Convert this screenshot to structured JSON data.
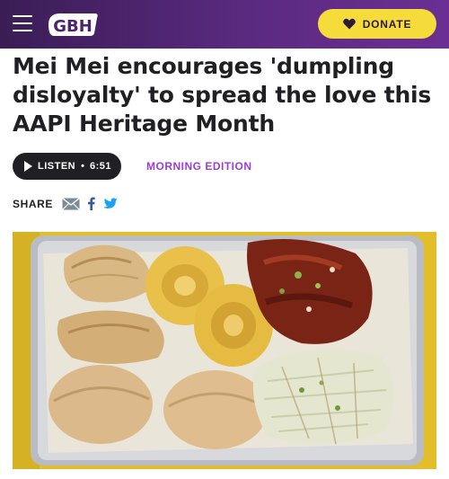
{
  "header": {
    "logo_text": "GBH",
    "donate_label": "DONATE",
    "icons": {
      "menu": "hamburger-menu-icon",
      "donate": "heart-icon"
    },
    "colors": {
      "bar": "#4a2470",
      "donate": "#f5dc3a"
    }
  },
  "article": {
    "headline": "Mei Mei encourages 'dumpling disloyalty' to spread the love this AAPI Heritage Month",
    "listen": {
      "label": "LISTEN",
      "separator": "•",
      "duration": "6:51"
    },
    "show_name": "MORNING EDITION",
    "share": {
      "label": "SHARE",
      "icons": [
        "email-icon",
        "facebook-icon",
        "twitter-icon"
      ]
    },
    "colors": {
      "show_link": "#9a3fd1",
      "facebook": "#3b5998",
      "twitter": "#1da1f2"
    }
  }
}
